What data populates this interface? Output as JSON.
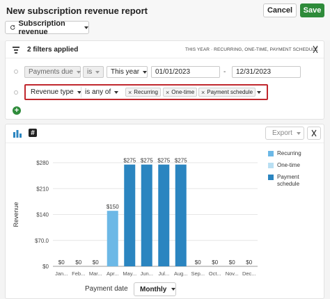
{
  "header": {
    "title": "New subscription revenue report",
    "cancel_label": "Cancel",
    "save_label": "Save",
    "metric_select": "Subscription revenue"
  },
  "filters": {
    "count_label": "2 filters applied",
    "summary": "THIS YEAR  ·  RECURRING, ONE-TIME, PAYMENT SCHEDULE",
    "row1": {
      "field": "Payments due",
      "operator": "is",
      "value": "This year",
      "start_date": "01/01/2023",
      "dash": "-",
      "end_date": "12/31/2023"
    },
    "row2": {
      "field": "Revenue type",
      "operator": "is any of",
      "chips": [
        "Recurring",
        "One-time",
        "Payment schedule"
      ]
    },
    "add_label": "+"
  },
  "chart_toolbar": {
    "export_label": "Export"
  },
  "colors": {
    "recurring": "#6cb8e6",
    "one_time": "#b9dff3",
    "payment_schedule": "#2b85c0",
    "accent": "#2e8b3a",
    "highlight": "#c0272d"
  },
  "chart_data": {
    "type": "bar",
    "categories": [
      "Jan...",
      "Feb...",
      "Mar...",
      "Apr...",
      "May...",
      "Jun...",
      "Jul...",
      "Aug...",
      "Sep...",
      "Oct...",
      "Nov...",
      "Dec..."
    ],
    "series": [
      {
        "name": "Recurring",
        "values": [
          0,
          0,
          0,
          150,
          0,
          0,
          0,
          0,
          0,
          0,
          0,
          0
        ]
      },
      {
        "name": "One-time",
        "values": [
          0,
          0,
          0,
          0,
          0,
          0,
          0,
          0,
          0,
          0,
          0,
          0
        ]
      },
      {
        "name": "Payment schedule",
        "values": [
          0,
          0,
          0,
          0,
          275,
          275,
          275,
          275,
          0,
          0,
          0,
          0
        ]
      }
    ],
    "data_labels": [
      "$0",
      "$0",
      "$0",
      "$150",
      "$275",
      "$275",
      "$275",
      "$275",
      "$0",
      "$0",
      "$0",
      "$0"
    ],
    "ylabel": "Revenue",
    "xlabel": "Payment date",
    "yticks": [
      0,
      70,
      140,
      210,
      280
    ],
    "ytick_labels": [
      "$0",
      "$70.0",
      "$140",
      "$210",
      "$280"
    ],
    "ylim": [
      0,
      280
    ],
    "grid": true,
    "legend": "right",
    "period": "Monthly"
  }
}
